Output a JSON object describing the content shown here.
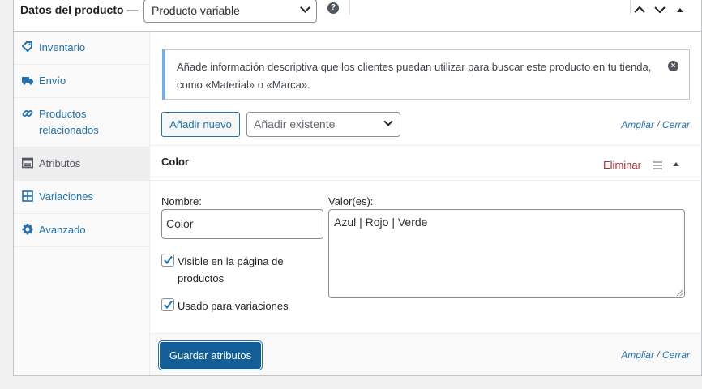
{
  "header": {
    "title": "Datos del producto —",
    "product_type": "Producto variable",
    "help_icon": "help-icon",
    "controls": [
      "chevron-up-icon",
      "chevron-down-icon",
      "collapse-up-icon"
    ]
  },
  "sidebar": {
    "items": [
      {
        "label": "Inventario",
        "icon": "tag-icon"
      },
      {
        "label": "Envío",
        "icon": "truck-icon"
      },
      {
        "label": "Productos relacionados",
        "icon": "link-icon"
      },
      {
        "label": "Atributos",
        "icon": "list-icon",
        "active": true
      },
      {
        "label": "Variaciones",
        "icon": "grid-icon"
      },
      {
        "label": "Avanzado",
        "icon": "gear-icon"
      }
    ]
  },
  "notice": {
    "text": "Añade información descriptiva que los clientes puedan utilizar para buscar este producto en tu tienda, como «Material» o «Marca».",
    "close_icon": "dismiss-icon"
  },
  "toolbar": {
    "add_new": "Añadir nuevo",
    "add_existing_placeholder": "Añadir existente",
    "expand": "Ampliar",
    "separator": "/",
    "close": "Cerrar"
  },
  "attribute": {
    "name": "Color",
    "remove": "Eliminar",
    "name_label": "Nombre:",
    "name_value": "Color",
    "values_label": "Valor(es):",
    "values_value": "Azul | Rojo | Verde",
    "visible_label": "Visible en la página de productos",
    "visible_checked": true,
    "variation_label": "Usado para variaciones",
    "variation_checked": true
  },
  "footer": {
    "save": "Guardar atributos",
    "expand": "Ampliar",
    "separator": "/",
    "close": "Cerrar"
  },
  "colors": {
    "accent": "#2271b1",
    "primary_button": "#135e96",
    "danger": "#b32d2e",
    "notice_border": "#72aee6"
  }
}
